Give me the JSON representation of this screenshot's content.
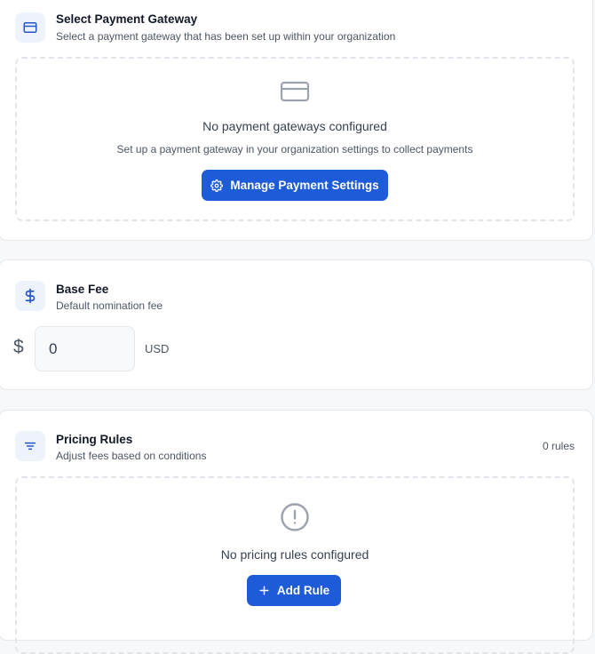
{
  "gateway": {
    "title": "Select Payment Gateway",
    "subtitle": "Select a payment gateway that has been set up within your organization",
    "icon": "credit-card-icon",
    "empty_title": "No payment gateways configured",
    "empty_subtitle": "Set up a payment gateway in your organization settings to collect payments",
    "button_label": "Manage Payment Settings",
    "button_icon": "gear-icon"
  },
  "base_fee": {
    "title": "Base Fee",
    "subtitle": "Default nomination fee",
    "icon": "dollar-icon",
    "currency_symbol": "$",
    "value": "0",
    "currency": "USD"
  },
  "pricing_rules": {
    "title": "Pricing Rules",
    "subtitle": "Adjust fees based on conditions",
    "icon": "filter-icon",
    "count_label": "0 rules",
    "empty_title": "No pricing rules configured",
    "empty_icon": "alert-circle-icon",
    "button_label": "Add Rule",
    "button_icon": "plus-icon"
  },
  "colors": {
    "accent": "#1d5bd8",
    "icon_bg": "#eef2fb",
    "border": "#e5e7eb"
  }
}
